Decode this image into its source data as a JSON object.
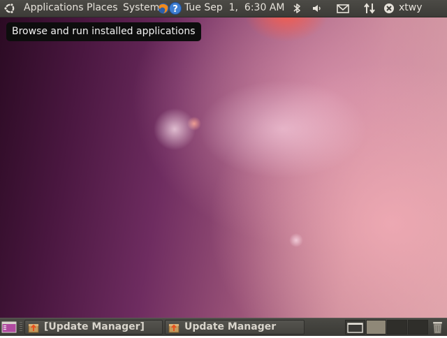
{
  "top_panel": {
    "menus": {
      "applications": "Applications",
      "places": "Places",
      "system": "System"
    },
    "launchers": [
      "firefox-icon",
      "help-icon"
    ],
    "clock": "Tue Sep  1,  6:30 AM",
    "tray_icons": [
      "bluetooth-icon",
      "volume-icon",
      "mail-icon",
      "network-icon",
      "user-status-icon"
    ],
    "username": "xtwy"
  },
  "tooltip": {
    "text": "Browse and run installed applications"
  },
  "bottom_panel": {
    "tasks": [
      {
        "label": "[Update Manager]",
        "icon": "update-manager-icon"
      },
      {
        "label": "Update Manager",
        "icon": "update-manager-icon"
      }
    ],
    "workspaces": 4,
    "active_workspace": 2
  },
  "colors": {
    "panel_bg": "#3c3b37",
    "panel_text": "#e6e2da",
    "tooltip_bg": "#0d0d0d",
    "wallpaper_dark": "#2a0a22",
    "wallpaper_light": "#d9a3a8"
  }
}
